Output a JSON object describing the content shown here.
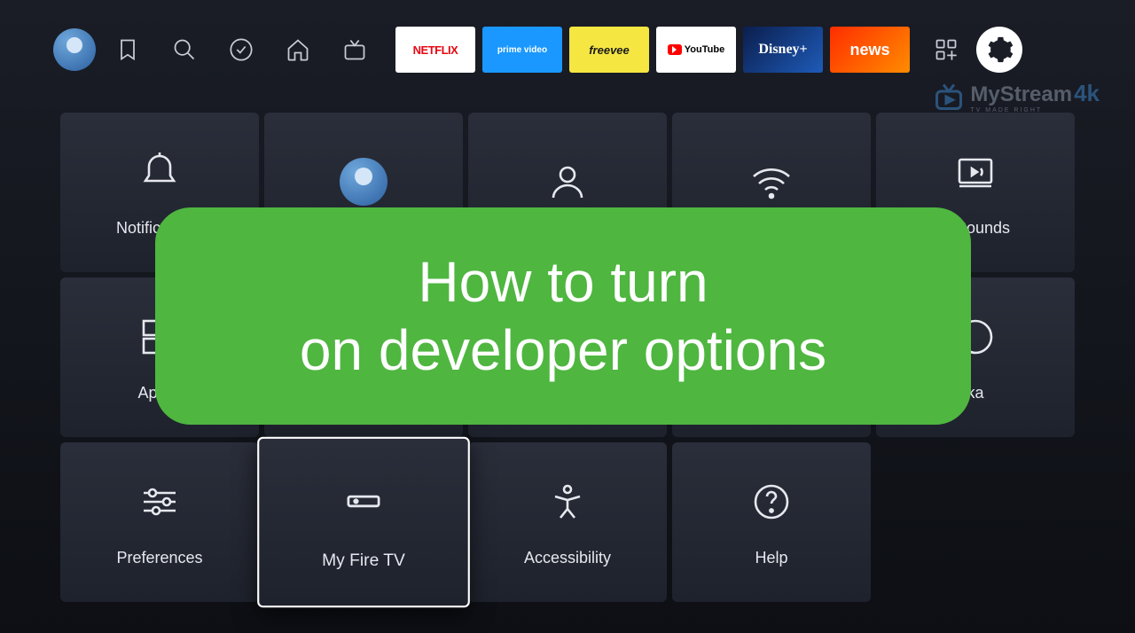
{
  "topbar": {
    "apps": {
      "netflix": "NETFLIX",
      "prime": "prime video",
      "freevee": "freevee",
      "youtube": "YouTube",
      "disney": "Disney+",
      "news": "news"
    }
  },
  "watermark": {
    "name": "MyStream",
    "suffix": "4k",
    "tagline": "TV MADE RIGHT"
  },
  "settings": {
    "row1": [
      {
        "label": "Notifications"
      },
      {
        "label": ""
      },
      {
        "label": ""
      },
      {
        "label": ""
      },
      {
        "label": "& Sounds"
      }
    ],
    "row2": [
      {
        "label": "Applic"
      },
      {
        "label": ""
      },
      {
        "label": ""
      },
      {
        "label": ""
      },
      {
        "label": "ka"
      }
    ],
    "row3": [
      {
        "label": "Preferences"
      },
      {
        "label": "My Fire TV"
      },
      {
        "label": "Accessibility"
      },
      {
        "label": "Help"
      }
    ]
  },
  "banner": {
    "line1": "How to turn",
    "line2": "on developer options"
  }
}
